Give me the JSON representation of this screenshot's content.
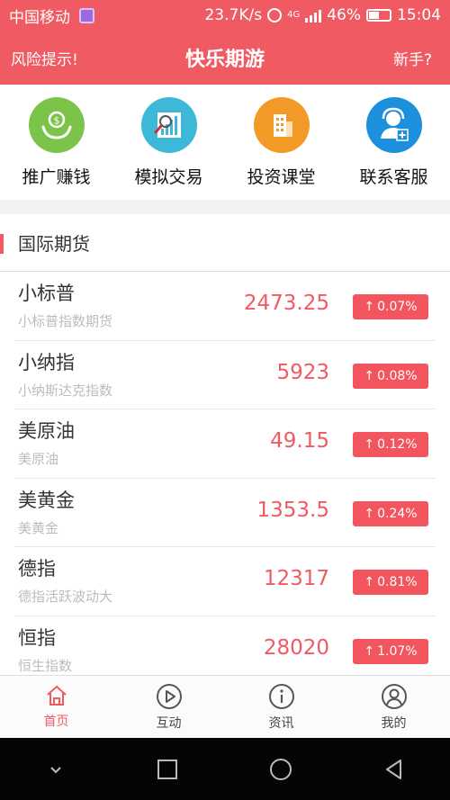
{
  "status": {
    "carrier": "中国移动",
    "speed": "23.7K/s",
    "network": "4G",
    "battery": "46%",
    "time": "15:04"
  },
  "topbar": {
    "risk_label": "风险提示!",
    "title": "快乐期游",
    "newbie_label": "新手?"
  },
  "quick": [
    {
      "label": "推广赚钱",
      "icon": "money-hand-icon",
      "color": "#7cc34a"
    },
    {
      "label": "模拟交易",
      "icon": "chart-magnifier-icon",
      "color": "#3db8d8"
    },
    {
      "label": "投资课堂",
      "icon": "building-icon",
      "color": "#f39a26"
    },
    {
      "label": "联系客服",
      "icon": "customer-service-icon",
      "color": "#1c8fdd"
    }
  ],
  "section": {
    "title": "国际期货",
    "items": [
      {
        "name": "小标普",
        "sub": "小标普指数期货",
        "price": "2473.25",
        "change": "0.07%"
      },
      {
        "name": "小纳指",
        "sub": "小纳斯达克指数",
        "price": "5923",
        "change": "0.08%"
      },
      {
        "name": "美原油",
        "sub": "美原油",
        "price": "49.15",
        "change": "0.12%"
      },
      {
        "name": "美黄金",
        "sub": "美黄金",
        "price": "1353.5",
        "change": "0.24%"
      },
      {
        "name": "德指",
        "sub": "德指活跃波动大",
        "price": "12317",
        "change": "0.81%"
      },
      {
        "name": "恒指",
        "sub": "恒生指数",
        "price": "28020",
        "change": "1.07%"
      }
    ]
  },
  "tabs": [
    {
      "label": "首页",
      "icon": "home-icon",
      "active": true
    },
    {
      "label": "互动",
      "icon": "play-circle-icon",
      "active": false
    },
    {
      "label": "资讯",
      "icon": "info-circle-icon",
      "active": false
    },
    {
      "label": "我的",
      "icon": "user-icon",
      "active": false
    }
  ],
  "colors": {
    "accent": "#f05a62",
    "change_badge": "#f2555e"
  }
}
